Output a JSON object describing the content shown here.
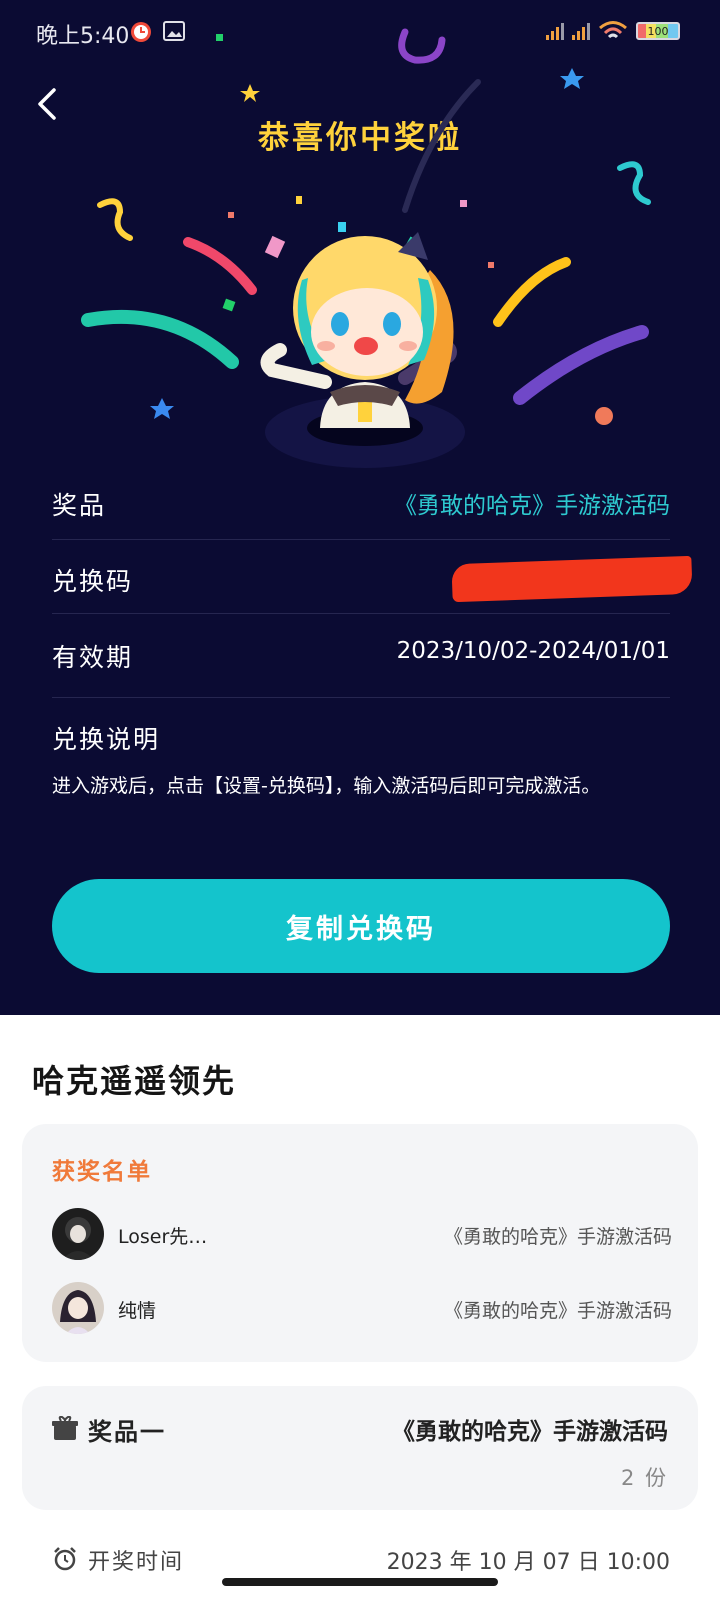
{
  "status_bar": {
    "time": "晚上5:40",
    "battery": "100",
    "icons": [
      "alarm-icon",
      "gallery-icon",
      "signal-icon",
      "wifi-icon",
      "battery-icon"
    ]
  },
  "header": {
    "title": "恭喜你中奖啦",
    "back_icon": "chevron-left-icon"
  },
  "prize_info": {
    "prize_label": "奖品",
    "prize_value": "《勇敢的哈克》手游激活码",
    "code_label": "兑换码",
    "validity_label": "有效期",
    "validity_value": "2023/10/02-2024/01/01",
    "desc_title": "兑换说明",
    "desc_text": "进入游戏后，点击【设置-兑换码】，输入激活码后即可完成激活。"
  },
  "copy_button": "复制兑换码",
  "section_title": "哈克遥遥领先",
  "winners": {
    "title": "获奖名单",
    "list": [
      {
        "name": "Loser先…",
        "prize": "《勇敢的哈克》手游激活码"
      },
      {
        "name": "纯情",
        "prize": "《勇敢的哈克》手游激活码"
      }
    ]
  },
  "prize_card": {
    "label": "奖品一",
    "name": "《勇敢的哈克》手游激活码",
    "count": "2 份"
  },
  "draw_time": {
    "label": "开奖时间",
    "value": "2023 年 10 月 07 日 10:00"
  },
  "colors": {
    "background_dark": "#0b0b33",
    "accent_teal": "#14c4cc",
    "title_yellow": "#ffd23c",
    "winners_orange": "#f07a3a",
    "redaction_red": "#f2361c"
  }
}
